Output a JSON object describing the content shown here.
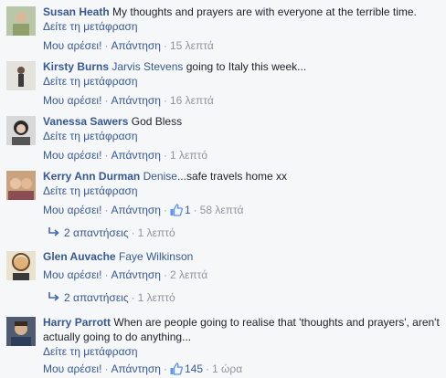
{
  "labels": {
    "see_translation": "Δείτε τη μετάφραση",
    "like": "Μου αρέσει!",
    "reply": "Απάντηση",
    "dot": "·"
  },
  "comments": [
    {
      "author": "Susan Heath",
      "tag": "",
      "text": "My thoughts and prayers are with everyone at the terrible time.",
      "time": "15 λεπτά",
      "likes": ""
    },
    {
      "author": "Kirsty Burns",
      "tag": "Jarvis Stevens",
      "text": "going to Italy this week...",
      "time": "16 λεπτά",
      "likes": ""
    },
    {
      "author": "Vanessa Sawers",
      "tag": "",
      "text": "God Bless",
      "time": "1 λεπτό",
      "likes": ""
    },
    {
      "author": "Kerry Ann Durman",
      "tag": "Denise",
      "text": "...safe travels home xx",
      "time": "58 λεπτά",
      "likes": "1",
      "replies": "2 απαντήσεις",
      "replies_time": "1 λεπτό"
    },
    {
      "author": "Glen Auvache",
      "tag": "Faye Wilkinson",
      "text": "",
      "time": "2 λεπτά",
      "likes": "",
      "replies": "2 απαντήσεις",
      "replies_time": "1 λεπτό"
    },
    {
      "author": "Harry Parrott",
      "tag": "",
      "text": "When are people going to realise that 'thoughts and prayers', aren't actually going to do anything...",
      "time": "1 ώρα",
      "likes": "145"
    }
  ],
  "colors": {
    "link": "#365899",
    "meta": "#90949c",
    "background": "#f6f7f9"
  }
}
